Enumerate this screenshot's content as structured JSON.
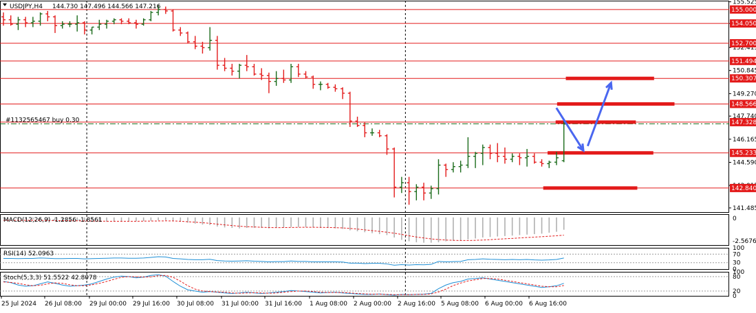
{
  "header": {
    "symbol": "USDJPY,H4",
    "ohlc": "144.730 147.496 144.566 147.216"
  },
  "colors": {
    "bull": "#1a6b1a",
    "bear": "#e31a1a",
    "level_line": "#e31a1a",
    "label_bg": "#e31a1a",
    "grid": "#000000",
    "arrow": "#4a67f0",
    "macd": "#b0b0b0",
    "signal": "#e31a1a",
    "rsi": "#1e8fd6",
    "stoch_main": "#1e8fd6",
    "stoch_signal": "#e31a1a"
  },
  "chart_data": [
    {
      "type": "candlestick",
      "title": "USDJPY,H4",
      "ylim": [
        141.2,
        155.6
      ],
      "price_ticks": [
        "155.525",
        "154.050",
        "152.415",
        "150.845",
        "149.270",
        "147.740",
        "146.165",
        "144.590",
        "143.015",
        "141.485"
      ],
      "time_labels": [
        "25 Jul 2024",
        "26 Jul 08:00",
        "29 Jul 00:00",
        "29 Jul 16:00",
        "30 Jul 08:00",
        "31 Jul 00:00",
        "31 Jul 16:00",
        "1 Aug 08:00",
        "2 Aug 00:00",
        "2 Aug 16:00",
        "5 Aug 08:00",
        "6 Aug 00:00",
        "6 Aug 16:00"
      ],
      "candles": [
        {
          "o": 154.5,
          "h": 154.8,
          "l": 153.9,
          "c": 154.3
        },
        {
          "o": 154.3,
          "h": 154.6,
          "l": 153.9,
          "c": 154.0
        },
        {
          "o": 154.0,
          "h": 154.5,
          "l": 153.6,
          "c": 154.3
        },
        {
          "o": 154.3,
          "h": 154.5,
          "l": 153.8,
          "c": 154.1
        },
        {
          "o": 154.1,
          "h": 154.5,
          "l": 153.8,
          "c": 154.2
        },
        {
          "o": 154.2,
          "h": 154.8,
          "l": 153.9,
          "c": 154.7
        },
        {
          "o": 154.7,
          "h": 154.9,
          "l": 154.2,
          "c": 154.5
        },
        {
          "o": 154.5,
          "h": 154.6,
          "l": 153.4,
          "c": 153.9
        },
        {
          "o": 153.9,
          "h": 154.2,
          "l": 153.7,
          "c": 154.0
        },
        {
          "o": 154.0,
          "h": 154.2,
          "l": 153.8,
          "c": 154.0
        },
        {
          "o": 154.0,
          "h": 154.6,
          "l": 153.5,
          "c": 154.1
        },
        {
          "o": 154.1,
          "h": 154.2,
          "l": 153.3,
          "c": 153.6
        },
        {
          "o": 153.6,
          "h": 153.8,
          "l": 153.3,
          "c": 153.8
        },
        {
          "o": 153.8,
          "h": 154.3,
          "l": 153.6,
          "c": 154.0
        },
        {
          "o": 154.0,
          "h": 154.3,
          "l": 153.7,
          "c": 154.2
        },
        {
          "o": 154.2,
          "h": 154.4,
          "l": 154.0,
          "c": 154.3
        },
        {
          "o": 154.3,
          "h": 154.4,
          "l": 154.0,
          "c": 154.2
        },
        {
          "o": 154.2,
          "h": 154.4,
          "l": 154.0,
          "c": 154.1
        },
        {
          "o": 154.1,
          "h": 154.3,
          "l": 153.7,
          "c": 154.0
        },
        {
          "o": 154.0,
          "h": 154.4,
          "l": 153.9,
          "c": 154.3
        },
        {
          "o": 154.3,
          "h": 154.9,
          "l": 154.2,
          "c": 154.8
        },
        {
          "o": 154.8,
          "h": 155.3,
          "l": 154.6,
          "c": 155.0
        },
        {
          "o": 155.0,
          "h": 155.2,
          "l": 154.7,
          "c": 154.9
        },
        {
          "o": 154.9,
          "h": 155.0,
          "l": 153.5,
          "c": 153.6
        },
        {
          "o": 153.6,
          "h": 153.8,
          "l": 153.2,
          "c": 153.4
        },
        {
          "o": 153.4,
          "h": 153.5,
          "l": 152.7,
          "c": 152.8
        },
        {
          "o": 152.8,
          "h": 153.2,
          "l": 152.3,
          "c": 152.5
        },
        {
          "o": 152.5,
          "h": 152.8,
          "l": 152.0,
          "c": 152.4
        },
        {
          "o": 152.4,
          "h": 153.8,
          "l": 152.2,
          "c": 152.9
        },
        {
          "o": 152.9,
          "h": 153.2,
          "l": 150.9,
          "c": 151.2
        },
        {
          "o": 151.2,
          "h": 151.7,
          "l": 150.8,
          "c": 151.0
        },
        {
          "o": 151.0,
          "h": 151.3,
          "l": 150.5,
          "c": 150.8
        },
        {
          "o": 150.8,
          "h": 151.3,
          "l": 150.3,
          "c": 151.2
        },
        {
          "o": 151.2,
          "h": 151.9,
          "l": 150.8,
          "c": 151.1
        },
        {
          "o": 151.1,
          "h": 151.3,
          "l": 150.5,
          "c": 150.6
        },
        {
          "o": 150.6,
          "h": 151.0,
          "l": 150.2,
          "c": 150.5
        },
        {
          "o": 150.5,
          "h": 150.7,
          "l": 149.3,
          "c": 150.1
        },
        {
          "o": 150.1,
          "h": 150.8,
          "l": 149.8,
          "c": 150.3
        },
        {
          "o": 150.3,
          "h": 150.9,
          "l": 150.0,
          "c": 150.2
        },
        {
          "o": 150.2,
          "h": 151.3,
          "l": 150.0,
          "c": 151.1
        },
        {
          "o": 151.1,
          "h": 151.3,
          "l": 150.4,
          "c": 150.6
        },
        {
          "o": 150.6,
          "h": 150.8,
          "l": 150.3,
          "c": 150.4
        },
        {
          "o": 150.4,
          "h": 150.5,
          "l": 149.6,
          "c": 149.9
        },
        {
          "o": 149.9,
          "h": 150.1,
          "l": 149.5,
          "c": 149.9
        },
        {
          "o": 149.9,
          "h": 150.0,
          "l": 149.6,
          "c": 149.7
        },
        {
          "o": 149.7,
          "h": 149.9,
          "l": 149.4,
          "c": 149.6
        },
        {
          "o": 149.6,
          "h": 149.7,
          "l": 148.9,
          "c": 149.3
        },
        {
          "o": 149.3,
          "h": 149.4,
          "l": 147.0,
          "c": 147.4
        },
        {
          "o": 147.4,
          "h": 147.7,
          "l": 147.0,
          "c": 147.1
        },
        {
          "o": 147.1,
          "h": 147.3,
          "l": 146.3,
          "c": 146.6
        },
        {
          "o": 146.6,
          "h": 146.9,
          "l": 146.4,
          "c": 146.6
        },
        {
          "o": 146.6,
          "h": 146.8,
          "l": 146.3,
          "c": 146.4
        },
        {
          "o": 146.4,
          "h": 146.5,
          "l": 145.1,
          "c": 145.5
        },
        {
          "o": 145.5,
          "h": 145.6,
          "l": 142.2,
          "c": 142.9
        },
        {
          "o": 142.9,
          "h": 143.6,
          "l": 142.5,
          "c": 143.2
        },
        {
          "o": 143.2,
          "h": 143.6,
          "l": 141.7,
          "c": 142.6
        },
        {
          "o": 142.6,
          "h": 143.1,
          "l": 142.0,
          "c": 142.9
        },
        {
          "o": 142.9,
          "h": 143.2,
          "l": 142.0,
          "c": 142.5
        },
        {
          "o": 142.5,
          "h": 143.0,
          "l": 142.1,
          "c": 142.8
        },
        {
          "o": 142.8,
          "h": 144.8,
          "l": 142.4,
          "c": 144.4
        },
        {
          "o": 144.4,
          "h": 144.5,
          "l": 143.6,
          "c": 144.1
        },
        {
          "o": 144.1,
          "h": 144.6,
          "l": 143.9,
          "c": 144.3
        },
        {
          "o": 144.3,
          "h": 144.7,
          "l": 143.9,
          "c": 144.4
        },
        {
          "o": 144.4,
          "h": 146.3,
          "l": 144.2,
          "c": 145.0
        },
        {
          "o": 145.0,
          "h": 145.3,
          "l": 144.2,
          "c": 145.2
        },
        {
          "o": 145.2,
          "h": 145.8,
          "l": 144.4,
          "c": 145.6
        },
        {
          "o": 145.6,
          "h": 145.8,
          "l": 144.8,
          "c": 145.2
        },
        {
          "o": 145.2,
          "h": 145.9,
          "l": 144.6,
          "c": 145.0
        },
        {
          "o": 145.0,
          "h": 145.6,
          "l": 144.5,
          "c": 144.8
        },
        {
          "o": 144.8,
          "h": 145.2,
          "l": 144.6,
          "c": 145.0
        },
        {
          "o": 145.0,
          "h": 145.2,
          "l": 144.4,
          "c": 144.9
        },
        {
          "o": 144.9,
          "h": 145.5,
          "l": 144.3,
          "c": 145.0
        },
        {
          "o": 145.0,
          "h": 145.2,
          "l": 144.5,
          "c": 144.6
        },
        {
          "o": 144.6,
          "h": 144.8,
          "l": 144.3,
          "c": 144.5
        },
        {
          "o": 144.5,
          "h": 144.7,
          "l": 144.2,
          "c": 144.6
        },
        {
          "o": 144.6,
          "h": 145.3,
          "l": 144.4,
          "c": 144.9
        },
        {
          "o": 144.7,
          "h": 147.5,
          "l": 144.6,
          "c": 147.2
        }
      ],
      "levels": [
        {
          "price": 155.0,
          "label": "155.000"
        },
        {
          "price": 154.05,
          "label": "154.050"
        },
        {
          "price": 152.7,
          "label": "152.700"
        },
        {
          "price": 151.494,
          "label": "151.494"
        },
        {
          "price": 150.307,
          "label": "150.307"
        },
        {
          "price": 148.566,
          "label": "148.566"
        },
        {
          "price": 147.328,
          "label": "147.328"
        },
        {
          "price": 145.233,
          "label": "145.233"
        },
        {
          "price": 142.84,
          "label": "142.840"
        }
      ],
      "trade_line": {
        "price": 147.216,
        "label": "#1132565467 buy 0.30"
      },
      "zones": [
        {
          "price": 150.307,
          "from": 0.776,
          "to": 0.897
        },
        {
          "price": 148.566,
          "from": 0.764,
          "to": 0.925
        },
        {
          "price": 147.328,
          "from": 0.762,
          "to": 0.872
        },
        {
          "price": 145.233,
          "from": 0.751,
          "to": 0.896
        },
        {
          "price": 142.84,
          "from": 0.745,
          "to": 0.874
        }
      ],
      "arrows": [
        {
          "from": [
            0.763,
            148.3
          ],
          "to": [
            0.8,
            145.4
          ]
        },
        {
          "from": [
            0.806,
            145.7
          ],
          "to": [
            0.838,
            150.0
          ]
        }
      ],
      "vlines": [
        0.119,
        0.556
      ]
    },
    {
      "type": "bar",
      "title": "MACD(12,26,9) -1.2856 -1.8561",
      "ylabels": [
        "0",
        "-2.5676"
      ],
      "values": [
        -0.1,
        -0.15,
        -0.2,
        -0.2,
        -0.22,
        -0.25,
        -0.25,
        -0.3,
        -0.32,
        -0.33,
        -0.35,
        -0.4,
        -0.42,
        -0.45,
        -0.45,
        -0.45,
        -0.44,
        -0.42,
        -0.4,
        -0.38,
        -0.35,
        -0.3,
        -0.28,
        -0.35,
        -0.45,
        -0.55,
        -0.65,
        -0.75,
        -0.8,
        -0.95,
        -1.05,
        -1.1,
        -1.15,
        -1.1,
        -1.1,
        -1.1,
        -1.15,
        -1.1,
        -1.05,
        -1.0,
        -1.0,
        -1.0,
        -1.05,
        -1.1,
        -1.1,
        -1.15,
        -1.2,
        -1.35,
        -1.45,
        -1.55,
        -1.65,
        -1.75,
        -1.85,
        -2.1,
        -2.35,
        -2.5,
        -2.6,
        -2.65,
        -2.65,
        -2.6,
        -2.5,
        -2.45,
        -2.4,
        -2.3,
        -2.2,
        -2.1,
        -2.05,
        -2.0,
        -1.95,
        -1.9,
        -1.85,
        -1.8,
        -1.75,
        -1.7,
        -1.6,
        -1.5,
        -1.29
      ],
      "signal": [
        -0.3,
        -0.3,
        -0.3,
        -0.3,
        -0.3,
        -0.31,
        -0.32,
        -0.33,
        -0.34,
        -0.35,
        -0.36,
        -0.37,
        -0.38,
        -0.39,
        -0.4,
        -0.4,
        -0.4,
        -0.4,
        -0.4,
        -0.39,
        -0.38,
        -0.37,
        -0.36,
        -0.37,
        -0.4,
        -0.45,
        -0.5,
        -0.55,
        -0.62,
        -0.7,
        -0.78,
        -0.85,
        -0.92,
        -0.97,
        -1.0,
        -1.03,
        -1.06,
        -1.07,
        -1.06,
        -1.05,
        -1.04,
        -1.03,
        -1.03,
        -1.04,
        -1.05,
        -1.07,
        -1.1,
        -1.15,
        -1.22,
        -1.3,
        -1.38,
        -1.46,
        -1.55,
        -1.65,
        -1.78,
        -1.92,
        -2.05,
        -2.15,
        -2.25,
        -2.32,
        -2.37,
        -2.4,
        -2.42,
        -2.42,
        -2.4,
        -2.37,
        -2.33,
        -2.28,
        -2.24,
        -2.2,
        -2.15,
        -2.1,
        -2.06,
        -2.02,
        -1.97,
        -1.92,
        -1.86
      ]
    },
    {
      "type": "line",
      "title": "RSI(14) 52.0963",
      "ylabels": [
        "100",
        "70",
        "30",
        "0"
      ],
      "ylim": [
        0,
        100
      ],
      "levels": [
        70,
        30
      ],
      "values": [
        50,
        50,
        49,
        50,
        50,
        52,
        51,
        49,
        49,
        50,
        50,
        48,
        49,
        50,
        51,
        52,
        52,
        51,
        51,
        52,
        55,
        58,
        57,
        50,
        48,
        45,
        44,
        44,
        46,
        40,
        38,
        37,
        38,
        39,
        37,
        36,
        34,
        35,
        35,
        38,
        36,
        36,
        34,
        34,
        34,
        34,
        33,
        28,
        28,
        26,
        27,
        27,
        24,
        18,
        21,
        19,
        21,
        20,
        22,
        36,
        34,
        35,
        36,
        44,
        45,
        48,
        46,
        45,
        44,
        45,
        44,
        45,
        43,
        42,
        43,
        45,
        52
      ]
    },
    {
      "type": "line",
      "title": "Stoch(5,3,3) 51.5522 42.8078",
      "ylabels": [
        "100",
        "80",
        "20",
        "0"
      ],
      "ylim": [
        0,
        100
      ],
      "levels": [
        80,
        20
      ],
      "main": [
        60,
        55,
        45,
        40,
        42,
        50,
        58,
        52,
        45,
        40,
        42,
        45,
        50,
        60,
        70,
        78,
        82,
        80,
        75,
        78,
        85,
        88,
        82,
        60,
        40,
        25,
        20,
        15,
        18,
        15,
        12,
        10,
        12,
        15,
        12,
        10,
        12,
        15,
        18,
        22,
        20,
        18,
        15,
        12,
        14,
        15,
        12,
        10,
        8,
        6,
        6,
        8,
        5,
        3,
        6,
        5,
        6,
        7,
        10,
        30,
        45,
        55,
        60,
        70,
        72,
        75,
        70,
        65,
        60,
        55,
        50,
        45,
        40,
        35,
        38,
        42,
        52
      ],
      "signal": [
        58,
        56,
        52,
        46,
        42,
        44,
        50,
        54,
        52,
        46,
        42,
        42,
        46,
        52,
        60,
        69,
        77,
        80,
        79,
        78,
        79,
        84,
        85,
        77,
        61,
        42,
        28,
        20,
        18,
        16,
        15,
        12,
        11,
        12,
        13,
        12,
        11,
        12,
        15,
        18,
        20,
        20,
        18,
        15,
        14,
        14,
        14,
        12,
        10,
        8,
        7,
        7,
        6,
        5,
        5,
        5,
        6,
        6,
        8,
        16,
        28,
        43,
        53,
        62,
        67,
        72,
        72,
        70,
        65,
        60,
        55,
        50,
        45,
        40,
        38,
        38,
        43
      ]
    }
  ]
}
